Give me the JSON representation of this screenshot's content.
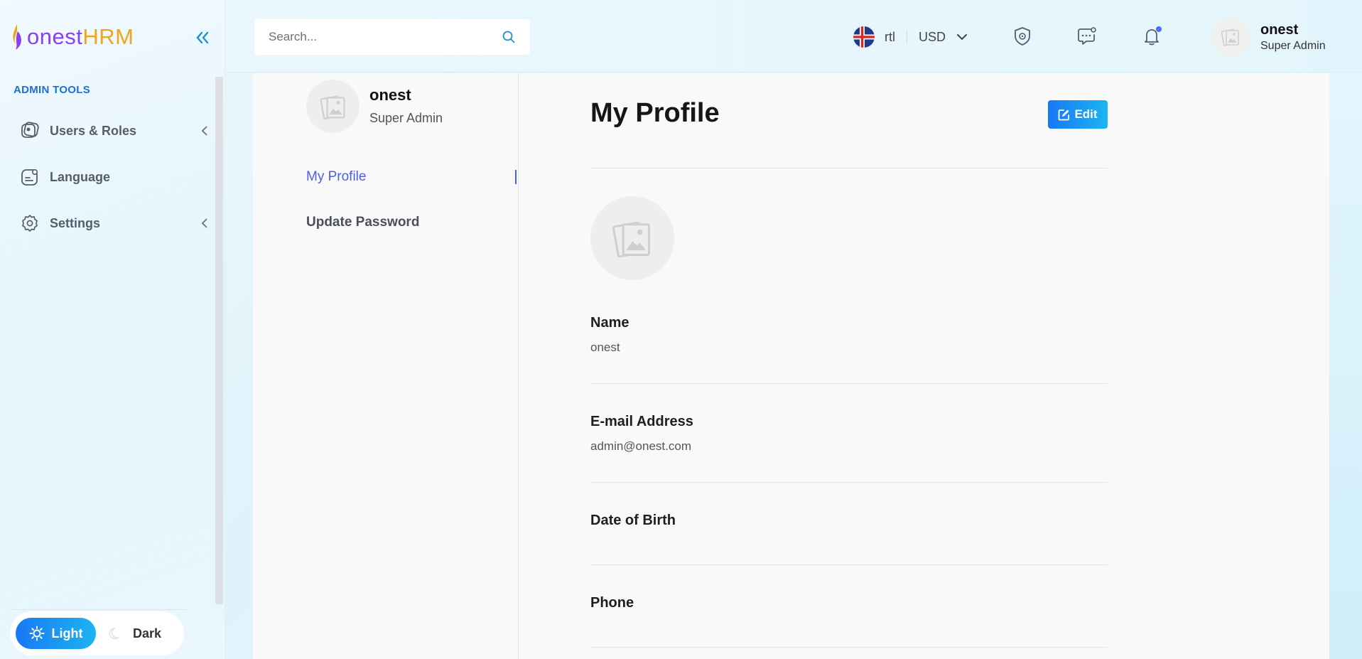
{
  "brand": {
    "logo_part1": "onest",
    "logo_part2": "HRM",
    "color_purple": "#8a3ff0",
    "color_orange": "#f5a21d"
  },
  "sidebar": {
    "section_title": "ADMIN TOOLS",
    "items": [
      {
        "label": "Users & Roles",
        "icon": "users-roles-icon",
        "has_submenu": true
      },
      {
        "label": "Language",
        "icon": "language-icon",
        "has_submenu": false
      },
      {
        "label": "Settings",
        "icon": "gear-icon",
        "has_submenu": true
      }
    ],
    "theme": {
      "light_label": "Light",
      "dark_label": "Dark",
      "active": "light"
    }
  },
  "header": {
    "search_placeholder": "Search...",
    "language_code": "rtl",
    "currency": "USD",
    "user": {
      "name": "onest",
      "role": "Super Admin"
    }
  },
  "profile_menu": {
    "name": "onest",
    "role": "Super Admin",
    "links": [
      {
        "label": "My Profile",
        "active": true
      },
      {
        "label": "Update Password",
        "active": false
      }
    ]
  },
  "profile": {
    "title": "My Profile",
    "edit_label": "Edit",
    "fields": [
      {
        "label": "Name",
        "value": "onest"
      },
      {
        "label": "E-mail Address",
        "value": "admin@onest.com"
      },
      {
        "label": "Date of Birth",
        "value": ""
      },
      {
        "label": "Phone",
        "value": ""
      }
    ]
  },
  "colors": {
    "accent": "#1878f5",
    "accent_light": "#1cb5f0",
    "active_link": "#4f5fe0"
  }
}
